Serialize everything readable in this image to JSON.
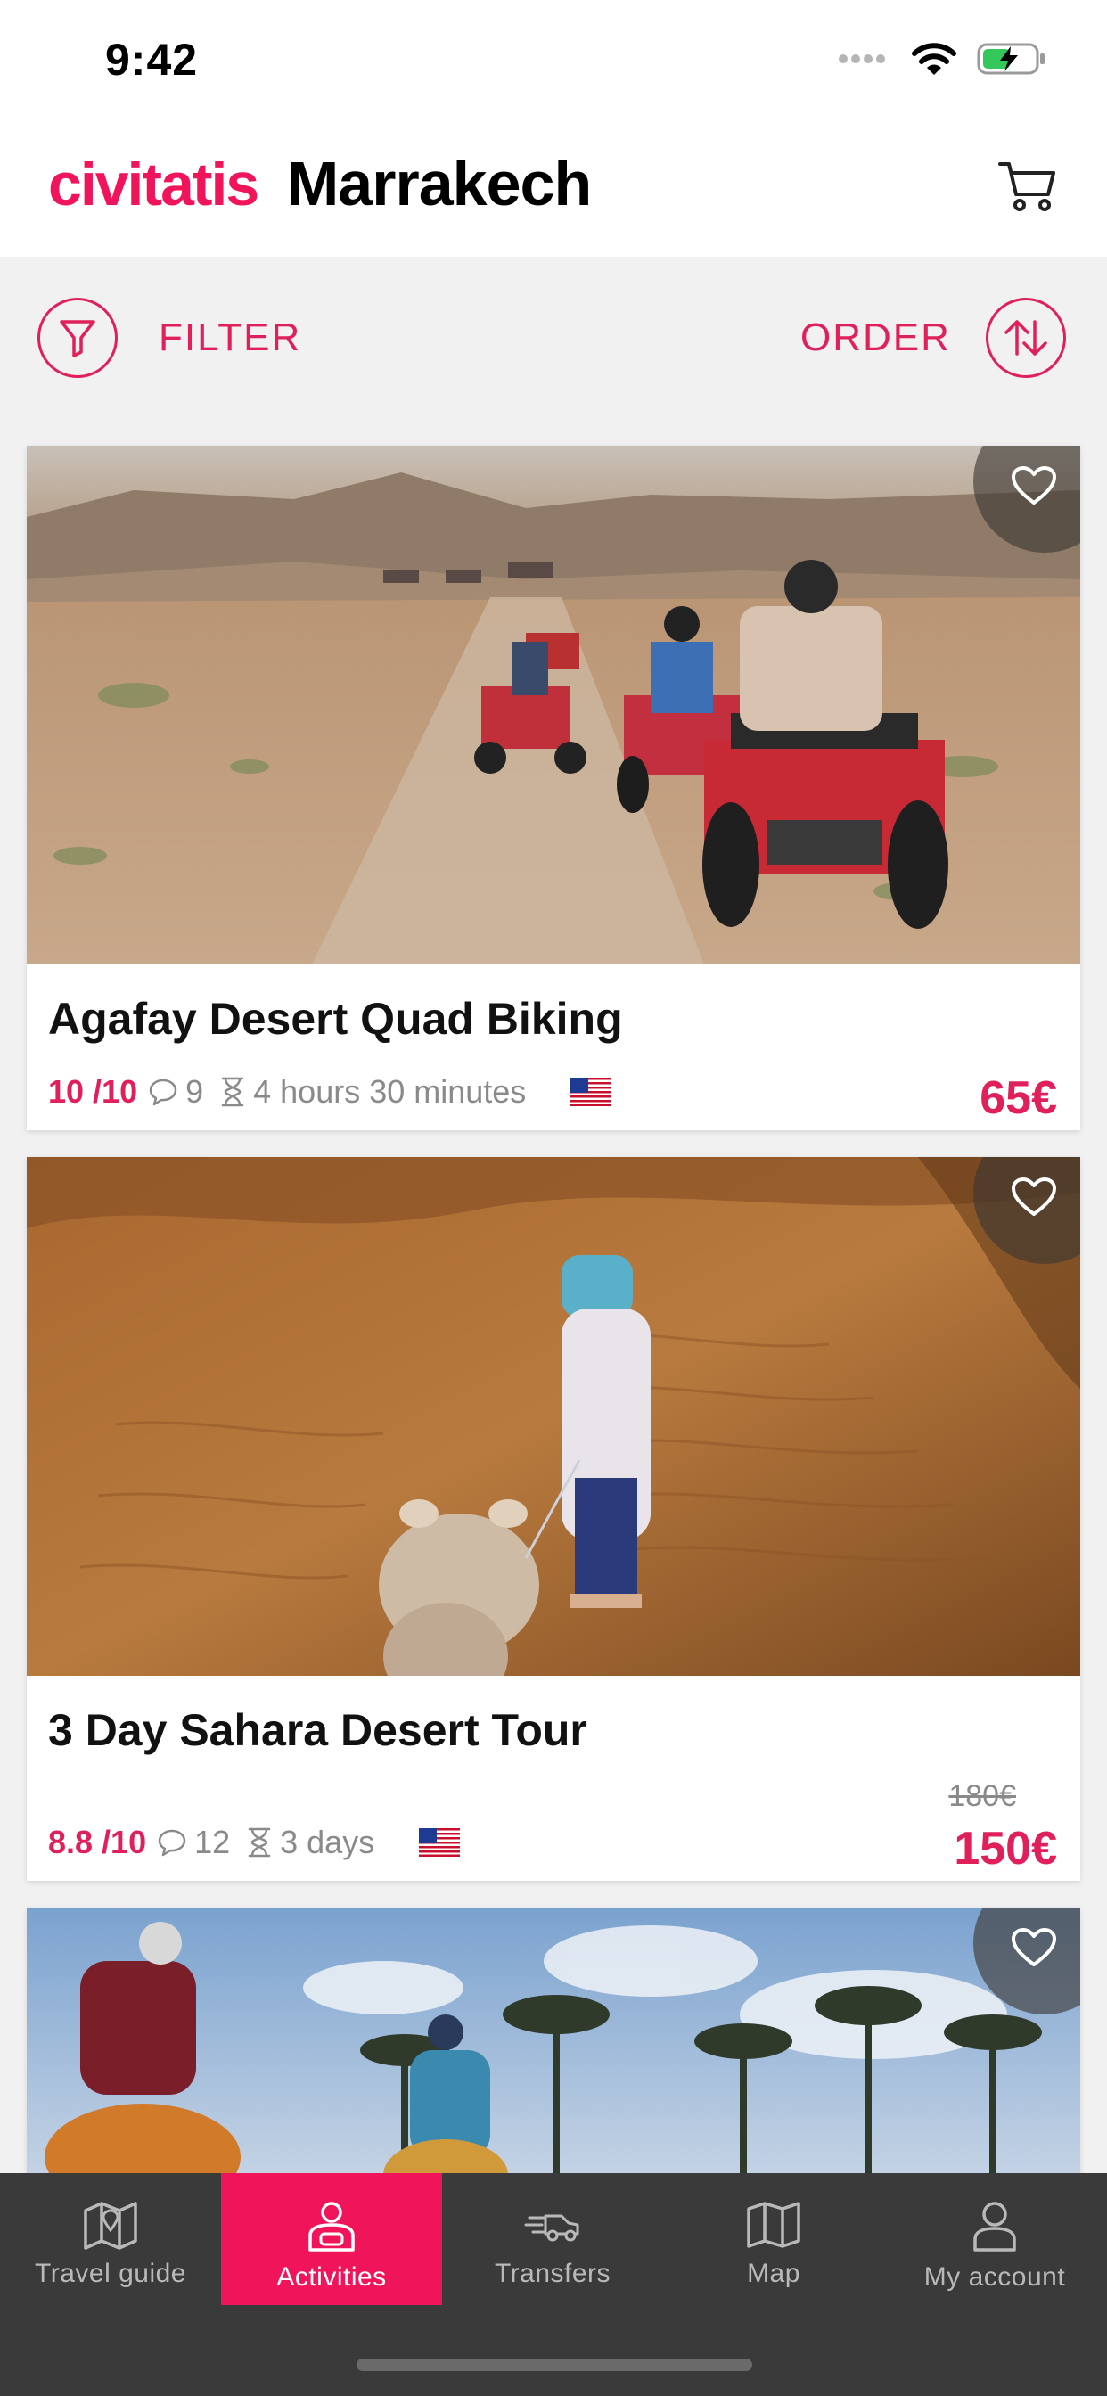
{
  "status_bar": {
    "time": "9:42",
    "icons": [
      "signal-dots-icon",
      "wifi-icon",
      "battery-charging-icon"
    ],
    "battery_color": "#34c759"
  },
  "header": {
    "brand": "civitatis",
    "city": "Marrakech",
    "cart_icon": "cart-icon"
  },
  "toolbar": {
    "filter_label": "FILTER",
    "order_label": "ORDER",
    "filter_icon": "filter-funnel-icon",
    "order_icon": "sort-arrows-icon"
  },
  "colors": {
    "accent": "#f0145a",
    "tab_bar": "#3a3a3a",
    "muted_text": "#8a8a8a"
  },
  "activities": [
    {
      "title": "Agafay Desert Quad Biking",
      "rating": "10 /10",
      "reviews": "9",
      "duration": "4 hours 30 minutes",
      "price": "65€",
      "language_flag": "us-flag-icon"
    },
    {
      "title": "3 Day Sahara Desert Tour",
      "rating": "8.8 /10",
      "reviews": "12",
      "duration": "3 days",
      "old_price": "180€",
      "price": "150€",
      "language_flag": "us-flag-icon"
    },
    {
      "title": "",
      "image": "camel-palm-grove-photo"
    }
  ],
  "tab_bar": {
    "active": "Activities",
    "tabs": [
      {
        "label": "Travel guide",
        "icon": "map-guide-icon"
      },
      {
        "label": "Activities",
        "icon": "activities-icon"
      },
      {
        "label": "Transfers",
        "icon": "transfers-icon"
      },
      {
        "label": "Map",
        "icon": "map-icon"
      },
      {
        "label": "My account",
        "icon": "user-icon"
      }
    ]
  }
}
